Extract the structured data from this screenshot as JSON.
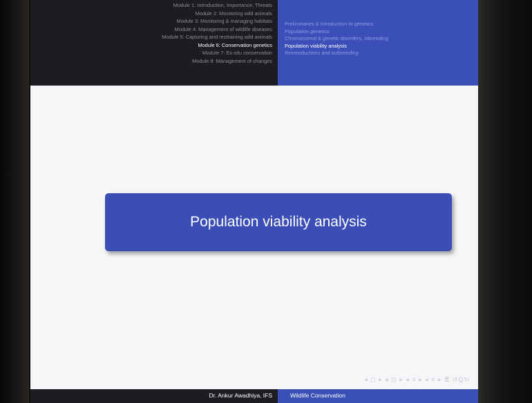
{
  "header": {
    "modules": [
      "Module 1: Introduction, Importance, Threats",
      "Module 2: Monitoring wild animals",
      "Module 3: Monitoring & managing habitats",
      "Module 4: Management of wildlife diseases",
      "Module 5: Capturing and restraining wild animals",
      "Module 6: Conservation genetics",
      "Module 7: Ex-situ conservation",
      "Module 8: Management of changes"
    ],
    "sections": [
      "Preliminaries & Introduction to genetics",
      "Population genetics",
      "Chromosomal & genetic disorders, inbreeding",
      "Population viability analysis",
      "Reintroductions and outbreeding"
    ]
  },
  "slide": {
    "title": "Population viability analysis",
    "nav_symbols": "◂ ◻ ▸ ◂ ⊡ ▸ ◂ ≡ ▸ ◂ ≡ ▸ ≣ ↺Q↻"
  },
  "footer": {
    "author": "Dr. Ankur Awadhiya, IFS",
    "course": "Wildlife Conservation"
  }
}
